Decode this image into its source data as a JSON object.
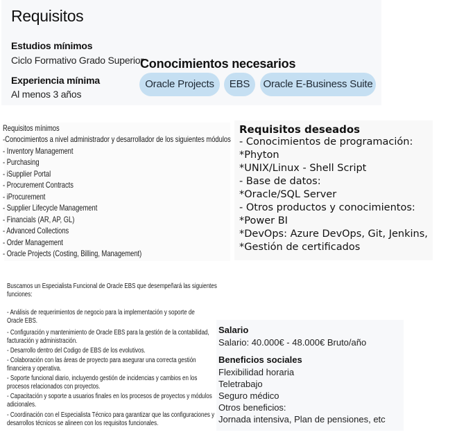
{
  "summary": {
    "title": "Requisitos",
    "studies_label": "Estudios mínimos",
    "studies_value": "Ciclo Formativo Grado Superior",
    "experience_label": "Experiencia mínima",
    "experience_value": "Al menos 3 años",
    "knowledge_title": "Conocimientos necesarios",
    "chips": [
      "Oracle Projects",
      "EBS",
      "Oracle E-Business Suite"
    ]
  },
  "min_requirements": {
    "lines": [
      "Requisitos mínimos",
      "-Conocimientos a nivel administrador y desarrollador de los siguientes módulos",
      "- Inventory Management",
      "- Purchasing",
      "- iSupplier Portal",
      "- Procurement Contracts",
      "- iProcurement",
      "- Supplier Lifecycle Management",
      "- Financials (AR, AP, GL)",
      "- Advanced Collections",
      "- Order Management",
      "- Oracle Projects (Costing, Billing, Management)"
    ]
  },
  "desired": {
    "title": "Requisitos deseados",
    "lines": [
      "- Conocimientos de programación:",
      "*Phyton",
      "*UNIX/Linux - Shell Script",
      "- Base de datos:",
      "*Oracle/SQL Server",
      "- Otros productos y conocimientos:",
      "*Power BI",
      "*DevOps: Azure DevOps, Git, Jenkins,",
      "*Gestión de certificados"
    ]
  },
  "description": {
    "lines": [
      "Buscamos un Especialista Funcional de Oracle EBS que desempeñará las siguientes",
      "funciones:",
      "",
      "- Análisis de requerimientos de negocio para la implementación y soporte de",
      "Oracle EBS.",
      "- Configuración y mantenimiento de Oracle EBS para la gestión de la contabilidad,",
      "facturación y administración.",
      "- Desarrollo dentro del Codigo de EBS de los evolutivos.",
      "- Colaboración con las áreas de proyecto para asegurar una correcta gestión",
      "financiera y operativa.",
      "- Soporte funcional diario, incluyendo gestión de incidencias y cambios en los",
      "procesos relacionados con proyectos.",
      "- Capacitación y soporte a usuarios finales en los procesos de proyectos y módulos",
      "adicionales.",
      "- Coordinación con el Especialista Técnico para garantizar que las configuraciones y",
      "desarrollos técnicos se alineen con los requisitos funcionales."
    ]
  },
  "compensation": {
    "salary_label": "Salario",
    "salary_value": "Salario: 40.000€ - 48.000€ Bruto/año",
    "benefits_label": "Beneficios sociales",
    "benefits": [
      "Flexibilidad horaria",
      "Teletrabajo",
      "Seguro médico",
      "Otros beneficios:",
      "Jornada intensiva, Plan de pensiones, etc"
    ]
  }
}
